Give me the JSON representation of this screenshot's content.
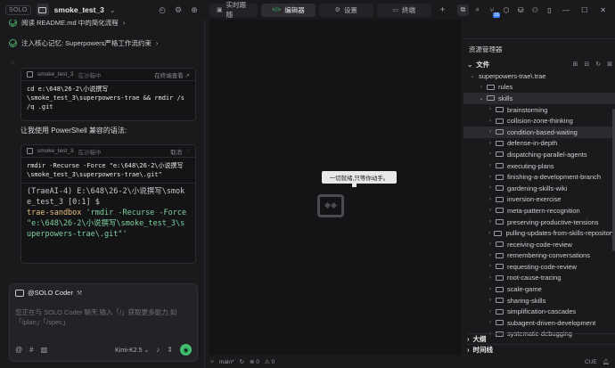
{
  "left": {
    "badge": "SOLO",
    "project": "smoke_test_3",
    "tasks": [
      {
        "text": "阅读 README.md 中的简化流程"
      },
      {
        "text": "注入核心记忆: Superpowers严格工作流约束"
      }
    ],
    "term1": {
      "name": "smoke_test_3",
      "status": "在沙箱中",
      "action": "在终端查看 ↗",
      "cmd": "cd e:\\648\\26-2\\小说撰写\n\\smoke_test_3\\superpowers-trae && rmdir /s\n/q .git"
    },
    "paragraph": "让我使用 PowerShell 兼容的语法:",
    "term2": {
      "name": "smoke_test_3",
      "status": "在沙箱中",
      "action": "取消",
      "cmd": "rmdir -Recurse -Force \"e:\\648\\26-2\\小说撰写\n\\smoke_test_3\\superpowers-trae\\.git\"",
      "out1": "(TraeAI-4) E:\\648\\26-2\\小说撰写\\smok\ne_test_3 [0:1] $",
      "out2_a": "trae-sandbox",
      "out2_b": " 'rmdir -Recurse -Force",
      "out3": "\"e:\\648\\26-2\\小说撰写\\smoke_test_3\\s\nuperpowers-trae\\.git\"'"
    },
    "composer": {
      "agent": "@SOLO Coder",
      "placeholder": "您正在与 SOLO Coder 聊天,输入「/」获取更多能力,如「/plan」「/spec」",
      "model": "Kimi-K2.5 ⌄"
    }
  },
  "tabs": [
    {
      "label": "实时跟随",
      "icon": "▣"
    },
    {
      "label": "编辑器",
      "icon": "</>"
    },
    {
      "label": "设置",
      "icon": "⚙"
    },
    {
      "label": "终端",
      "icon": "▭"
    }
  ],
  "editor": {
    "tooltip": "一切就绪,只等你动手。"
  },
  "explorer": {
    "title": "资源管理器",
    "files_label": "文件",
    "outline_label": "大纲",
    "timeline_label": "时间线",
    "tree": [
      {
        "label": "superpowers-trae\\.trae",
        "indent": 0,
        "open": true,
        "folder": false
      },
      {
        "label": "rules",
        "indent": 1,
        "open": false,
        "folder": true
      },
      {
        "label": "skills",
        "indent": 1,
        "open": true,
        "folder": true,
        "sel": true
      },
      {
        "label": "brainstorming",
        "indent": 2,
        "open": false,
        "folder": true
      },
      {
        "label": "collision-zone-thinking",
        "indent": 2,
        "open": false,
        "folder": true
      },
      {
        "label": "condition-based-waiting",
        "indent": 2,
        "open": false,
        "folder": true,
        "sel": true
      },
      {
        "label": "defense-in-depth",
        "indent": 2,
        "open": false,
        "folder": true
      },
      {
        "label": "dispatching-parallel-agents",
        "indent": 2,
        "open": false,
        "folder": true
      },
      {
        "label": "executing-plans",
        "indent": 2,
        "open": false,
        "folder": true
      },
      {
        "label": "finishing-a-development-branch",
        "indent": 2,
        "open": false,
        "folder": true
      },
      {
        "label": "gardening-skills-wiki",
        "indent": 2,
        "open": false,
        "folder": true
      },
      {
        "label": "inversion-exercise",
        "indent": 2,
        "open": false,
        "folder": true
      },
      {
        "label": "meta-pattern-recognition",
        "indent": 2,
        "open": false,
        "folder": true
      },
      {
        "label": "preserving-productive-tensions",
        "indent": 2,
        "open": false,
        "folder": true
      },
      {
        "label": "pulling-updates-from-skills-repository",
        "indent": 2,
        "open": false,
        "folder": true
      },
      {
        "label": "receiving-code-review",
        "indent": 2,
        "open": false,
        "folder": true
      },
      {
        "label": "remembering-conversations",
        "indent": 2,
        "open": false,
        "folder": true
      },
      {
        "label": "requesting-code-review",
        "indent": 2,
        "open": false,
        "folder": true
      },
      {
        "label": "root-cause-tracing",
        "indent": 2,
        "open": false,
        "folder": true
      },
      {
        "label": "scale-game",
        "indent": 2,
        "open": false,
        "folder": true
      },
      {
        "label": "sharing-skills",
        "indent": 2,
        "open": false,
        "folder": true
      },
      {
        "label": "simplification-cascades",
        "indent": 2,
        "open": false,
        "folder": true
      },
      {
        "label": "subagent-driven-development",
        "indent": 2,
        "open": false,
        "folder": true
      },
      {
        "label": "systematic-debugging",
        "indent": 2,
        "open": false,
        "folder": true
      }
    ]
  },
  "status": {
    "branch": "main*",
    "lang": "CUE"
  },
  "colors": {
    "accent": "#3fbf6f",
    "badge": "#3b82f6"
  }
}
